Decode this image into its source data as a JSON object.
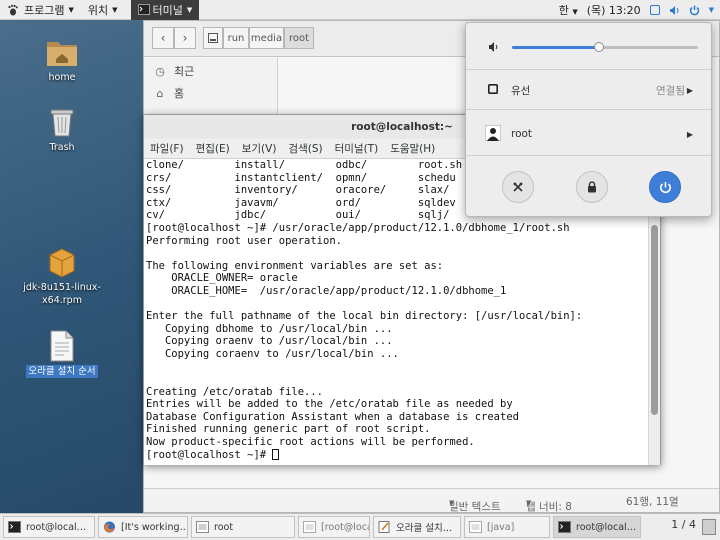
{
  "top_panel": {
    "applications": "프로그램",
    "places": "위치",
    "active_app": "터미널",
    "input_method": "한",
    "clock": "(목) 13:20"
  },
  "desktop": {
    "icons": [
      {
        "label": "home"
      },
      {
        "label": "Trash"
      },
      {
        "label": "jdk-8u151-linux-x64.rpm"
      },
      {
        "label": "오라클 설치 순서"
      }
    ]
  },
  "file_manager": {
    "path": [
      "run",
      "media",
      "root"
    ],
    "sidebar": [
      {
        "icon": "clock-icon",
        "label": "최근"
      },
      {
        "icon": "home-icon",
        "label": "홈"
      }
    ],
    "status": {
      "mode": "일반 텍스트",
      "tab_width": "탭 너비: 8",
      "position": "61행, 11열"
    }
  },
  "terminal": {
    "title": "root@localhost:~",
    "menu": [
      "파일(F)",
      "편집(E)",
      "보기(V)",
      "검색(S)",
      "터미널(T)",
      "도움말(H)"
    ],
    "lines": [
      "clone/        install/        odbc/        root.sh",
      "crs/          instantclient/  opmn/        schedu",
      "css/          inventory/      oracore/     slax/",
      "ctx/          javavm/         ord/         sqldev",
      "cv/           jdbc/           oui/         sqlj/",
      "[root@localhost ~]# /usr/oracle/app/product/12.1.0/dbhome_1/root.sh",
      "Performing root user operation.",
      "",
      "The following environment variables are set as:",
      "    ORACLE_OWNER= oracle",
      "    ORACLE_HOME=  /usr/oracle/app/product/12.1.0/dbhome_1",
      "",
      "Enter the full pathname of the local bin directory: [/usr/local/bin]:",
      "   Copying dbhome to /usr/local/bin ...",
      "   Copying oraenv to /usr/local/bin ...",
      "   Copying coraenv to /usr/local/bin ...",
      "",
      "",
      "Creating /etc/oratab file...",
      "Entries will be added to the /etc/oratab file as needed by",
      "Database Configuration Assistant when a database is created",
      "Finished running generic part of root script.",
      "Now product-specific root actions will be performed."
    ],
    "prompt": "[root@localhost ~]# ",
    "scroll_position": 0.55
  },
  "system_menu": {
    "volume": 0.47,
    "wired_label": "유선",
    "wired_status": "연결됨",
    "user": "root"
  },
  "taskbar": {
    "tasks": [
      {
        "icon": "terminal-icon",
        "label": "root@local…",
        "active": false
      },
      {
        "icon": "firefox-icon",
        "label": "[It's working…",
        "active": false
      },
      {
        "icon": "folder-icon",
        "label": "root",
        "active": false
      },
      {
        "icon": "folder-icon",
        "label": "[root@local…",
        "active": false
      },
      {
        "icon": "text-editor-icon",
        "label": "오라클 설치…",
        "active": false
      },
      {
        "icon": "java-icon",
        "label": "[java]",
        "active": false
      },
      {
        "icon": "terminal-icon",
        "label": "root@local…",
        "active": true
      }
    ],
    "workspace": "1 / 4"
  }
}
